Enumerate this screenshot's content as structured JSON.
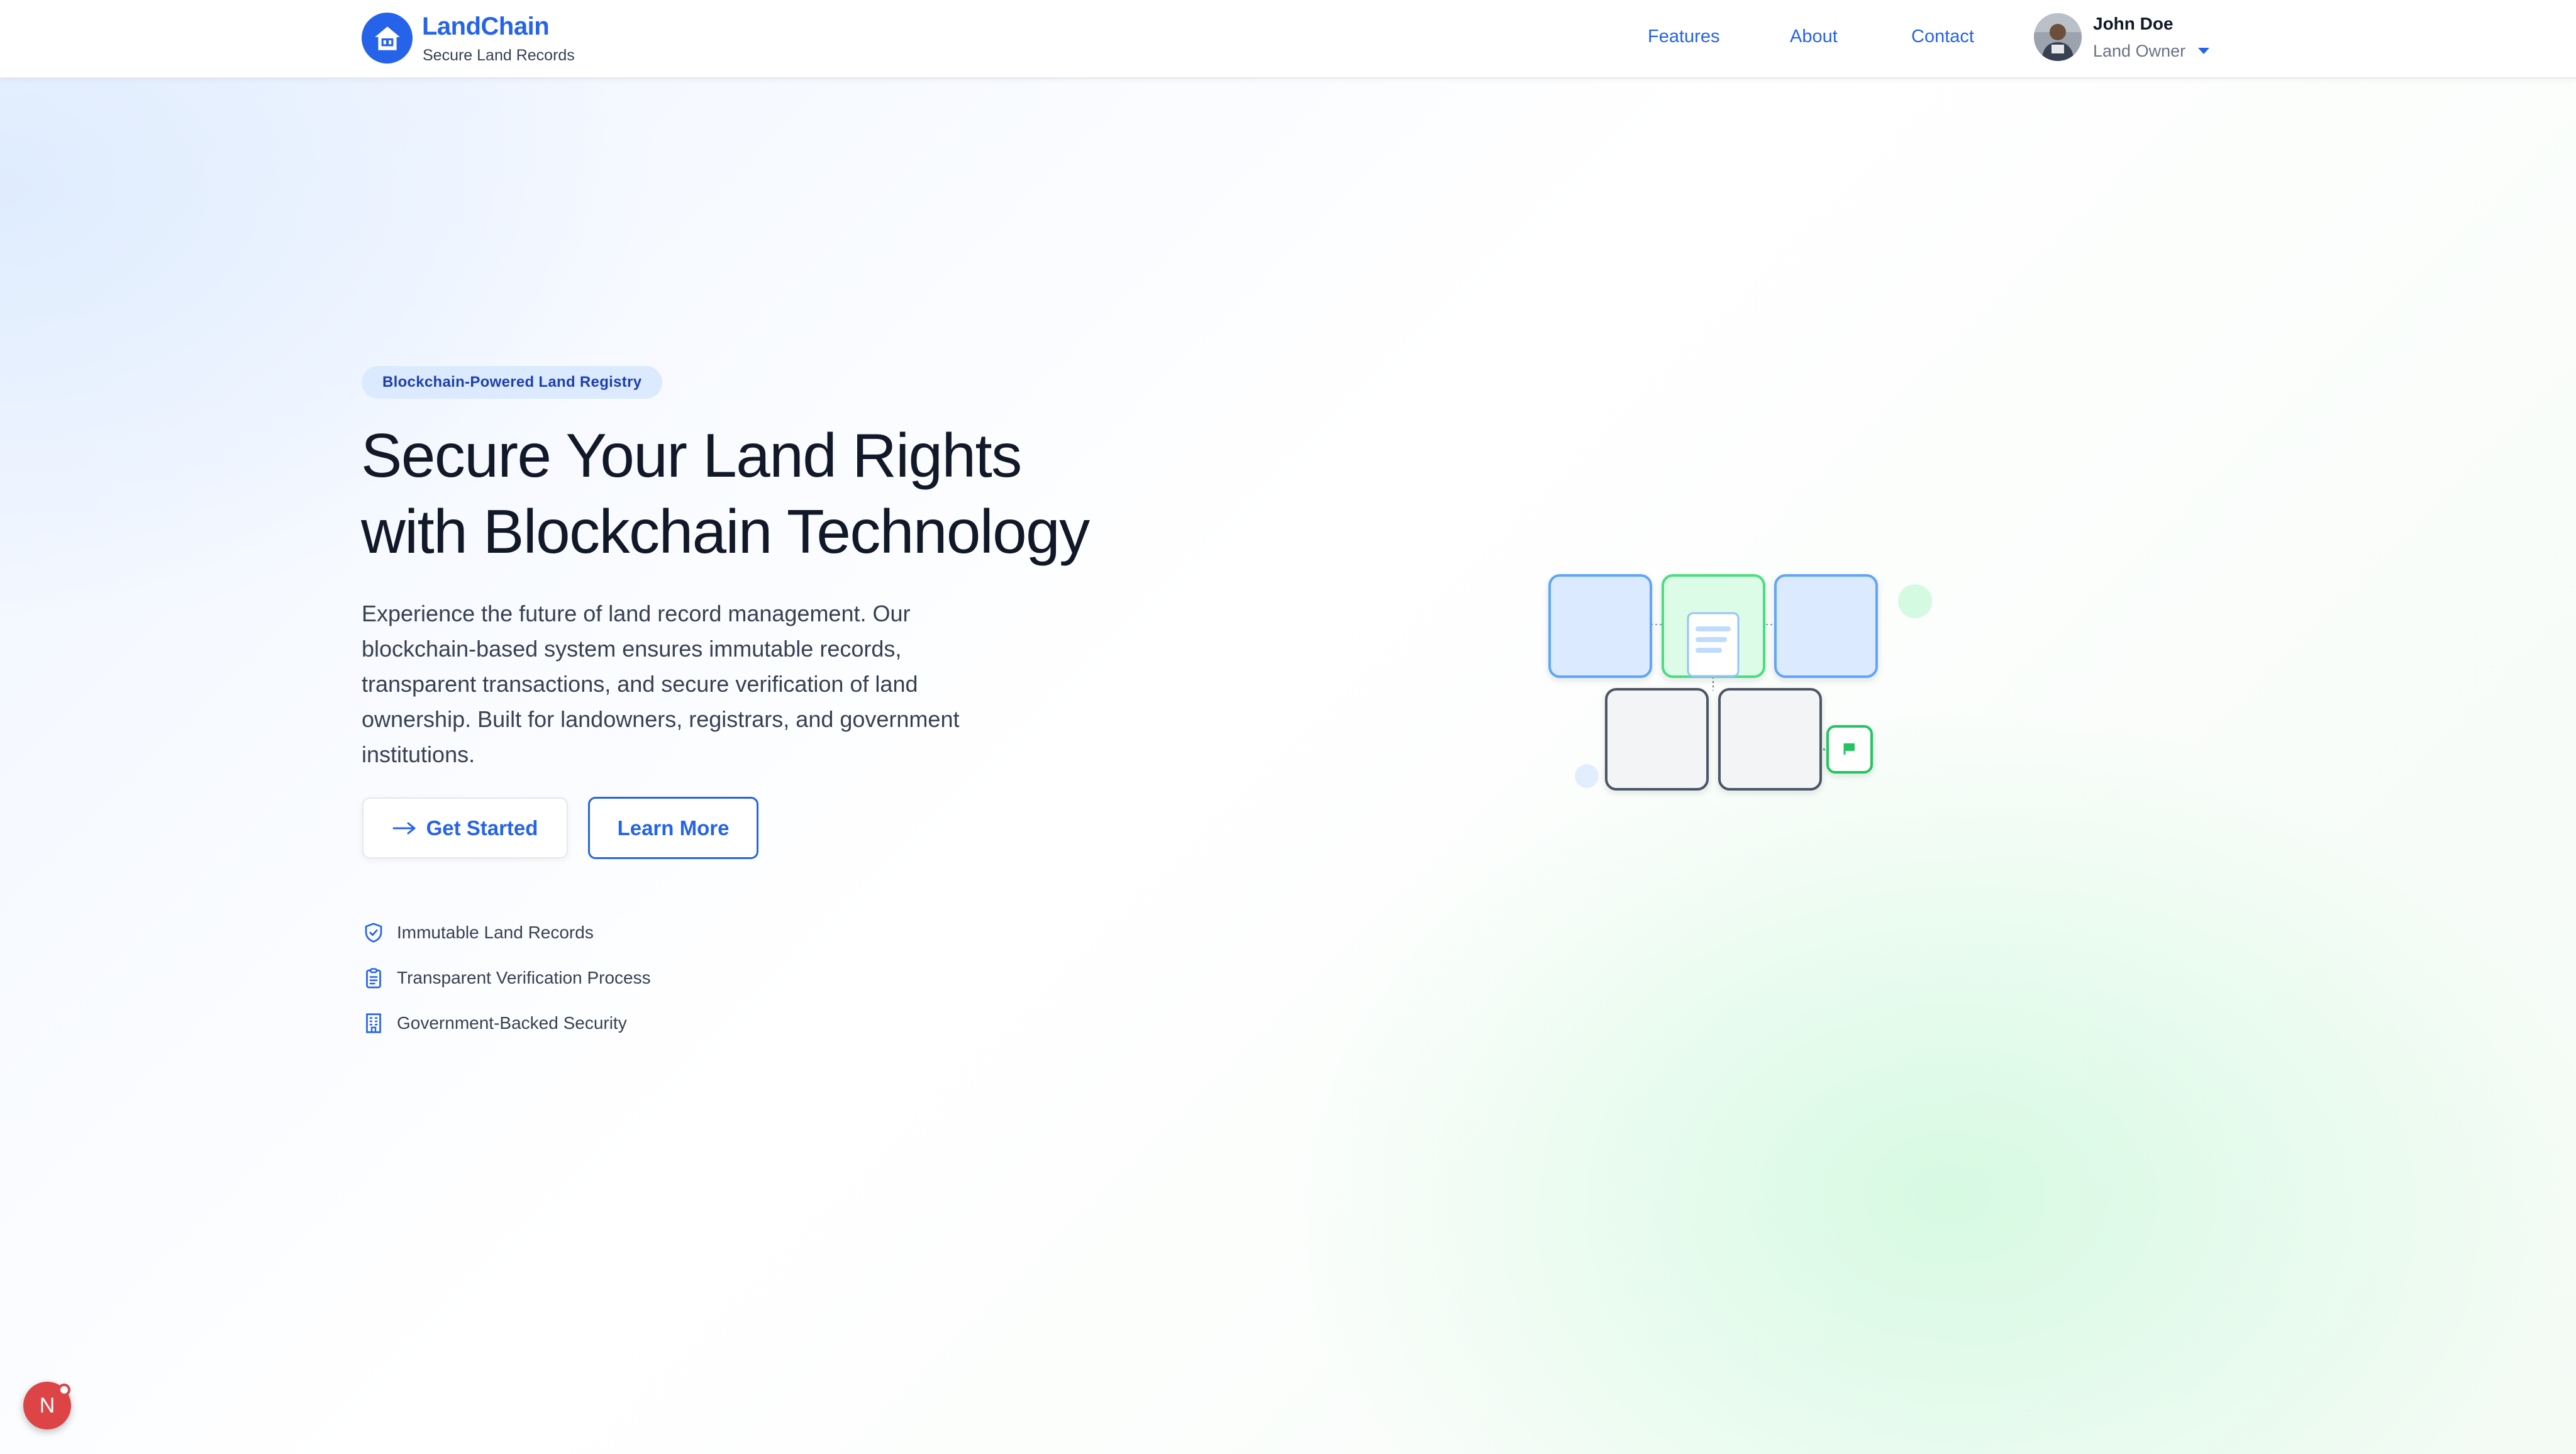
{
  "header": {
    "brand_name": "LandChain",
    "brand_tagline": "Secure Land Records",
    "logo_icon": "home-icon",
    "nav": [
      {
        "label": "Features"
      },
      {
        "label": "About"
      },
      {
        "label": "Contact"
      }
    ],
    "user": {
      "name": "John Doe",
      "role": "Land Owner",
      "avatar_icon": "user-avatar"
    }
  },
  "hero": {
    "badge": "Blockchain-Powered Land Registry",
    "title_line1": "Secure Your Land Rights",
    "title_line2": "with Blockchain Technology",
    "description": "Experience the future of land record management. Our blockchain-based system ensures immutable records, transparent transactions, and secure verification of land ownership. Built for landowners, registrars, and government institutions.",
    "primary_button": "Get Started",
    "secondary_button": "Learn More",
    "features": [
      {
        "label": "Immutable Land Records",
        "icon": "shield-check-icon"
      },
      {
        "label": "Transparent Verification Process",
        "icon": "clipboard-icon"
      },
      {
        "label": "Government-Backed Security",
        "icon": "building-icon"
      }
    ]
  },
  "dev_badge": {
    "label": "N"
  },
  "colors": {
    "accent": "#2563eb",
    "accent_light": "#dbeafe",
    "success": "#22c55e",
    "success_light": "#dcfce7",
    "text_primary": "#111827",
    "text_secondary": "#374151"
  }
}
